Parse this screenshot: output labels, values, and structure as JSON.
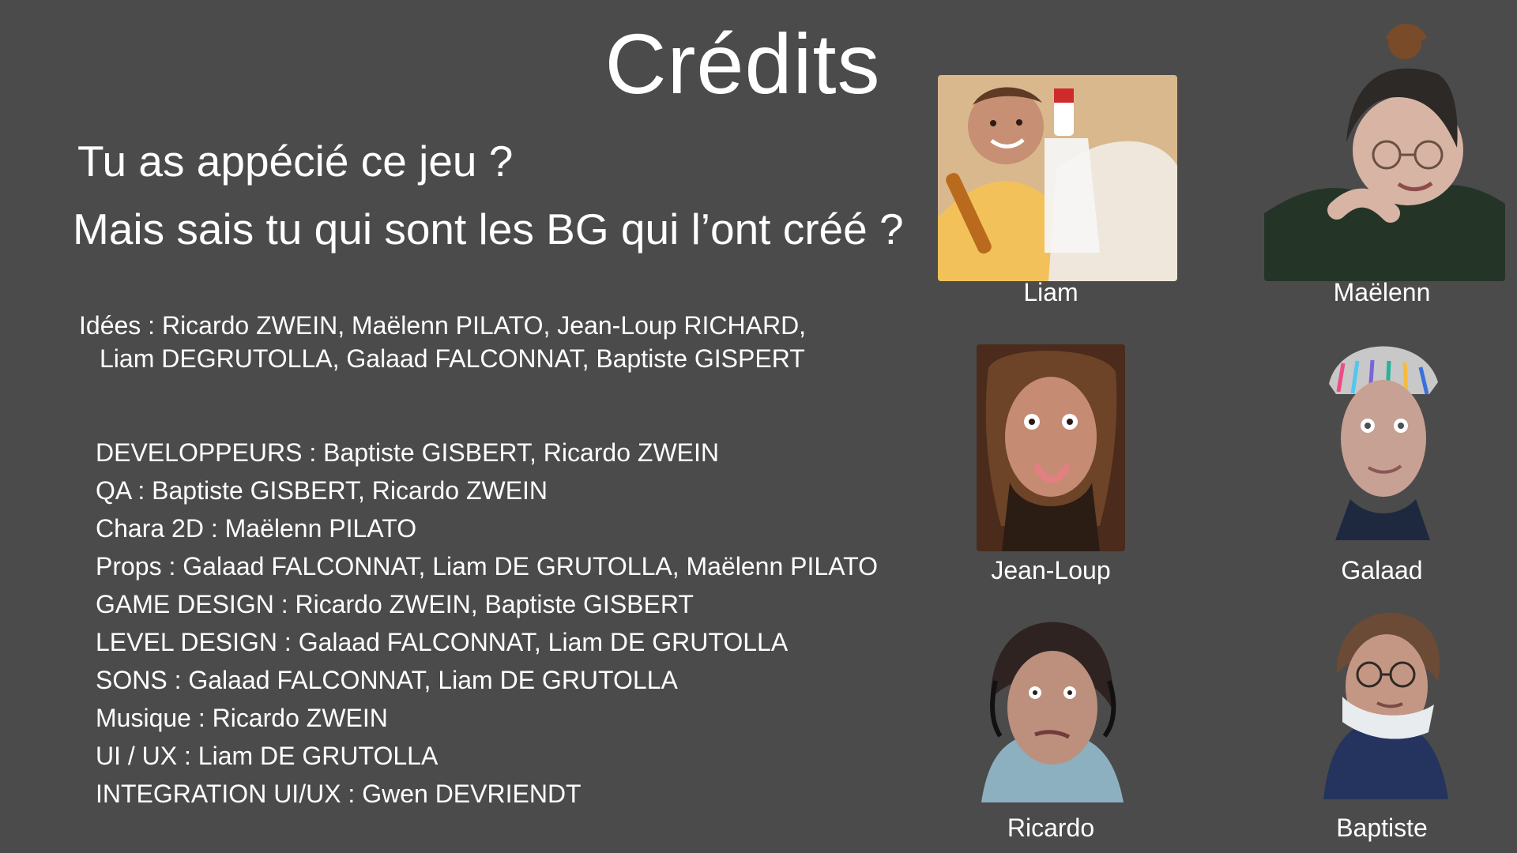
{
  "title": "Crédits",
  "intro": {
    "line1": "Tu as appécié ce jeu ?",
    "line2": "Mais sais tu qui sont les BG qui l’ont créé ?"
  },
  "ideas": {
    "line1": "Idées : Ricardo ZWEIN, Maëlenn PILATO, Jean-Loup RICHARD,",
    "line2": "Liam DEGRUTOLLA, Galaad FALCONNAT, Baptiste GISPERT"
  },
  "credits": [
    "DEVELOPPEURS : Baptiste GISBERT, Ricardo ZWEIN",
    "QA : Baptiste GISBERT, Ricardo ZWEIN",
    "Chara 2D : Maëlenn PILATO",
    "Props : Galaad FALCONNAT, Liam DE GRUTOLLA, Maëlenn PILATO",
    "GAME DESIGN : Ricardo ZWEIN, Baptiste GISBERT",
    "LEVEL DESIGN : Galaad FALCONNAT, Liam DE GRUTOLLA",
    "SONS : Galaad FALCONNAT, Liam DE GRUTOLLA",
    "Musique : Ricardo ZWEIN",
    "UI / UX : Liam DE GRUTOLLA",
    "INTEGRATION UI/UX : Gwen DEVRIENDT"
  ],
  "people": [
    {
      "name": "Liam"
    },
    {
      "name": "Maëlenn"
    },
    {
      "name": "Jean-Loup"
    },
    {
      "name": "Galaad"
    },
    {
      "name": "Ricardo"
    },
    {
      "name": "Baptiste"
    }
  ],
  "colors": {
    "background": "#4b4b4b",
    "text": "#ffffff"
  }
}
